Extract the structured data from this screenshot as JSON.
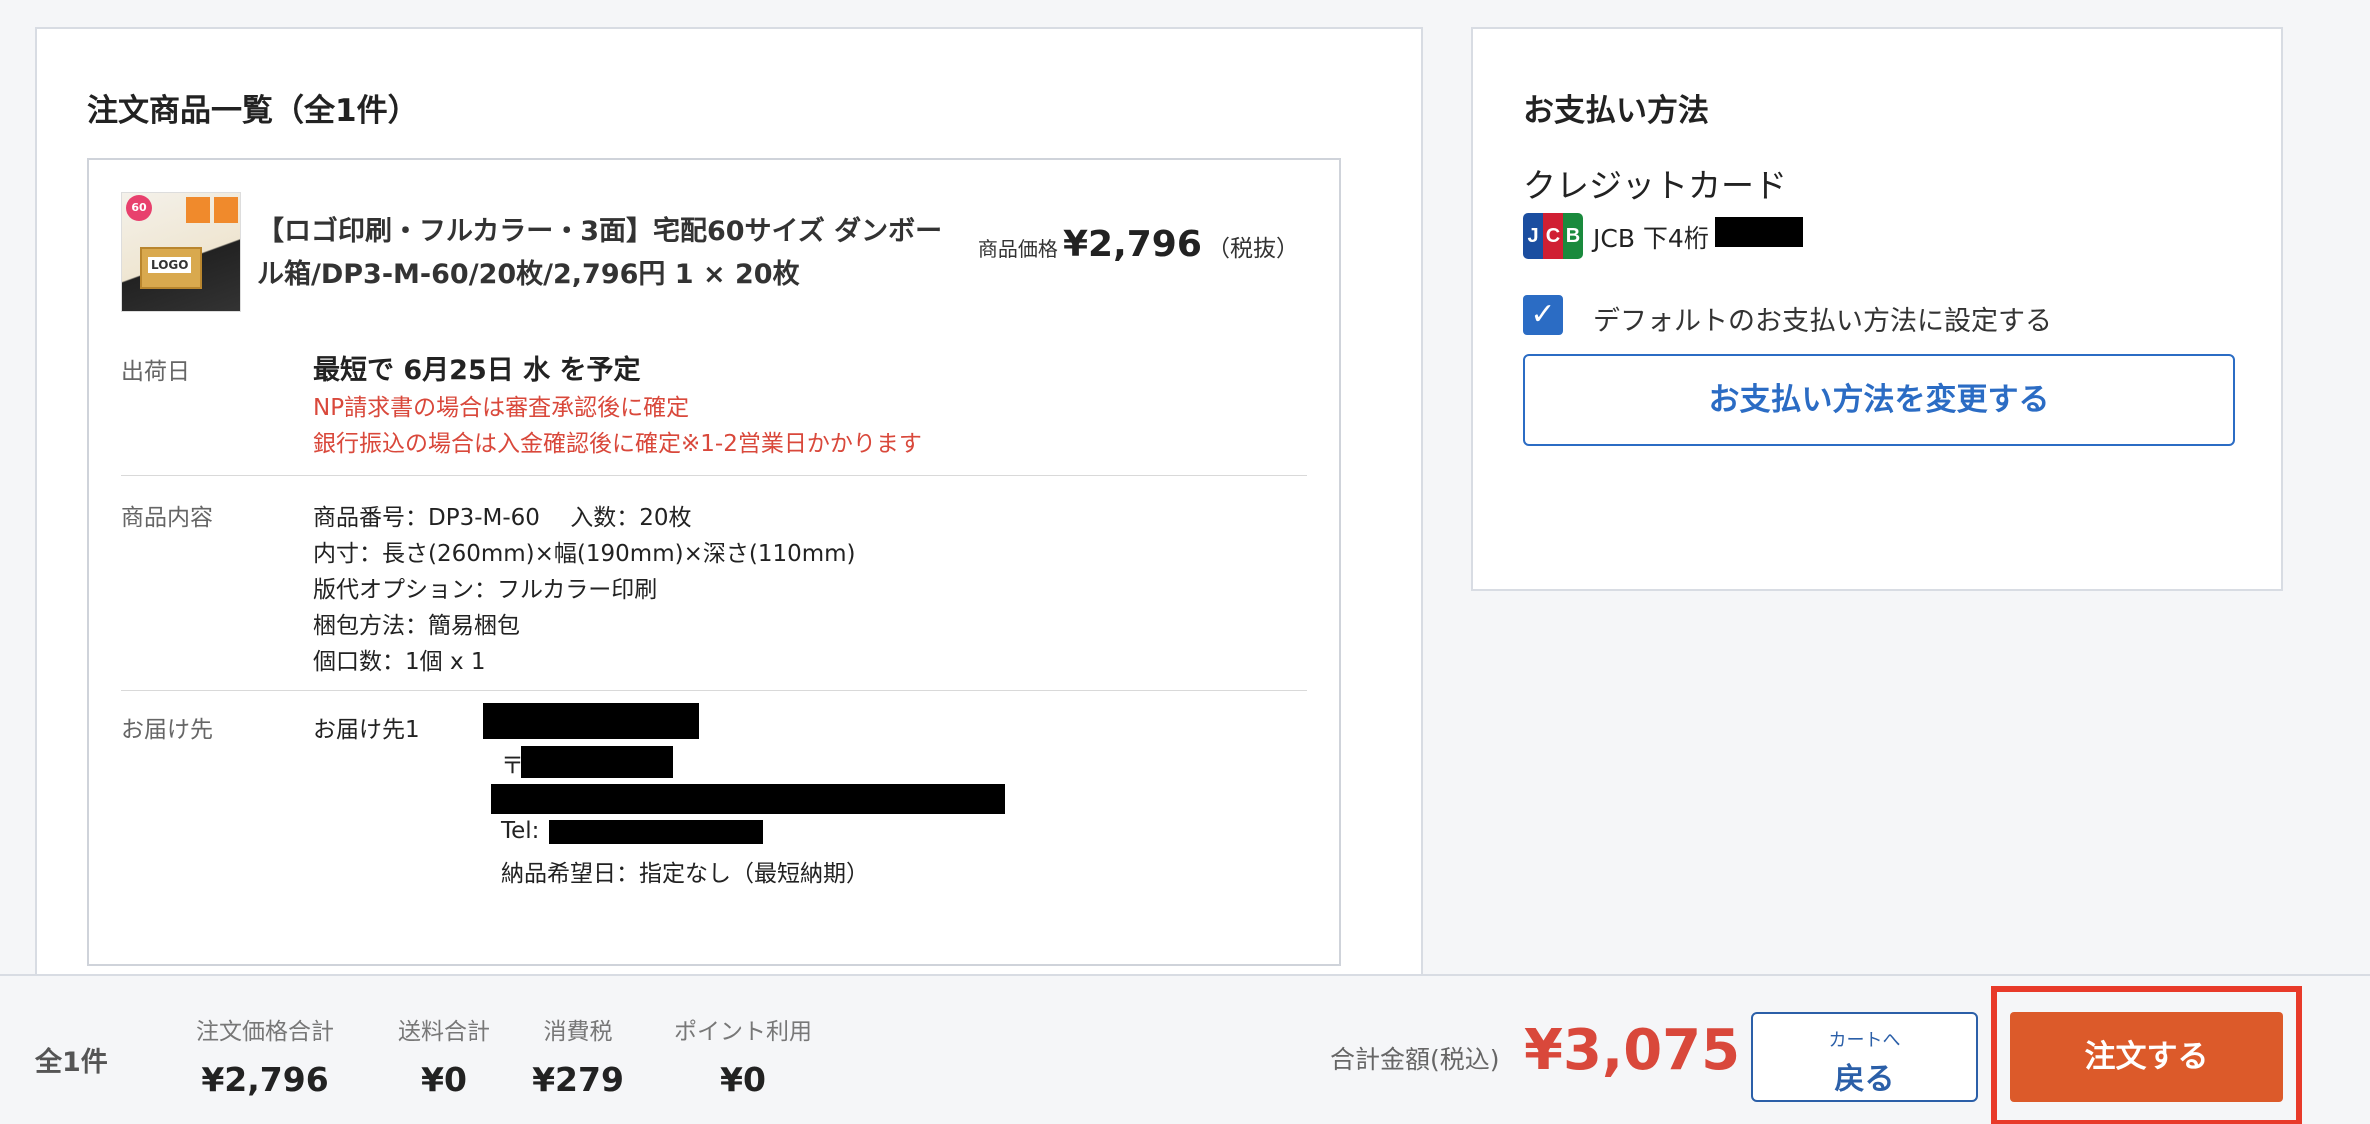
{
  "order_list": {
    "title": "注文商品一覧（全1件）",
    "product": {
      "name_line1": "【ロゴ印刷・フルカラー・3面】宅配60サイズ ダンボー",
      "name_line2": "ル箱/DP3-M-60/20枚/2,796円 1 × 20枚",
      "price_label": "商品価格",
      "price_value": "¥2,796",
      "price_tax": "（税抜）",
      "thumbnail_text": {
        "badge": "60",
        "logo": "LOGO"
      }
    },
    "shipping": {
      "label": "出荷日",
      "main": "最短で  6月25日 水  を予定",
      "note1": "NP請求書の場合は審査承認後に確定",
      "note2": "銀行振込の場合は入金確認後に確定※1-2営業日かかります"
    },
    "contents": {
      "label": "商品内容",
      "lines": [
        "商品番号：DP3-M-60　 入数：20枚",
        "内寸：長さ(260mm)×幅(190mm)×深さ(110mm)",
        "版代オプション：フルカラー印刷",
        "梱包方法：簡易梱包",
        "個口数：1個 x 1"
      ]
    },
    "delivery": {
      "label": "お届け先",
      "dest_label": "お届け先1",
      "postal_prefix": "〒",
      "tel_prefix": "Tel:",
      "desired_date": "納品希望日：指定なし（最短納期）"
    }
  },
  "payment": {
    "title": "お支払い方法",
    "method": "クレジットカード",
    "card_brand": "JCB",
    "card_digits_label": "JCB 下4桁",
    "default_checkbox_label": "デフォルトのお支払い方法に設定する",
    "default_checked": true,
    "change_button": "お支払い方法を変更する"
  },
  "footer": {
    "count": "全1件",
    "subtotal_label": "注文価格合計",
    "subtotal_value": "¥2,796",
    "shipping_label": "送料合計",
    "shipping_value": "¥0",
    "tax_label": "消費税",
    "tax_value": "¥279",
    "points_label": "ポイント利用",
    "points_value": "¥0",
    "total_label": "合計金額(税込)",
    "total_value": "¥3,075",
    "back_small": "カートへ",
    "back_big": "戻る",
    "order_button": "注文する"
  },
  "colors": {
    "accent_blue": "#2b6cc4",
    "alert_red": "#d9483b",
    "order_orange": "#dc5a2a",
    "highlight_red": "#e83a2a"
  }
}
